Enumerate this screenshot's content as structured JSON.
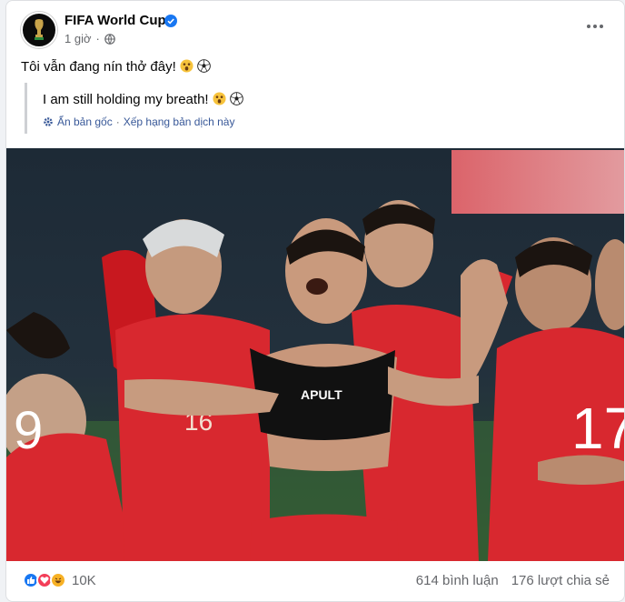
{
  "post": {
    "page_name": "FIFA World Cup",
    "time": "1 giờ",
    "privacy_icon": "globe-icon",
    "verified_icon": "verified-badge-icon",
    "more_icon": "more-options-icon",
    "caption": "Tôi vẫn đang nín thở đây!",
    "caption_emojis": [
      "astonished-face-emoji",
      "soccer-ball-emoji"
    ]
  },
  "translation": {
    "text": "I am still holding my breath!",
    "show_original": "Ẩn bản gốc",
    "separator": "·",
    "rate_translation": "Xếp hạng bản dịch này"
  },
  "photo": {
    "jersey_numbers": [
      "9",
      "16",
      "17"
    ],
    "sponsor_text": "APULT"
  },
  "footer": {
    "reaction_icons": [
      "like-icon",
      "love-icon",
      "haha-icon"
    ],
    "reaction_count": "10K",
    "comments": "614 bình luận",
    "shares": "176 lượt chia sẻ"
  },
  "colors": {
    "link": "#385898",
    "secondary_text": "#65676b",
    "jersey_red": "#d8282f",
    "verified_blue": "#1877f2"
  }
}
